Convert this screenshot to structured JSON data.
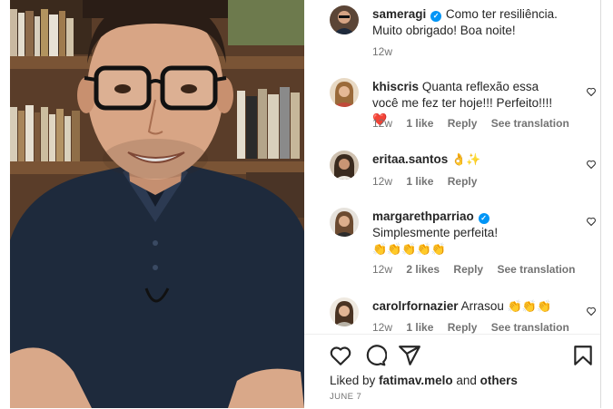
{
  "comments": [
    {
      "username": "sameragi",
      "verified": true,
      "text": "Como ter resiliência. Muito obrigado! Boa noite!",
      "time": "12w"
    },
    {
      "username": "khiscris",
      "verified": false,
      "text": "Quanta reflexão essa você me fez ter hoje!!! Perfeito!!!!",
      "emoji": "❤️",
      "time": "12w",
      "likes": "1 like",
      "reply": "Reply",
      "translate": "See translation"
    },
    {
      "username": "eritaa.santos",
      "verified": false,
      "text": "",
      "emoji": "👌✨",
      "time": "12w",
      "likes": "1 like",
      "reply": "Reply"
    },
    {
      "username": "margarethparriao",
      "verified": true,
      "text": "Simplesmente perfeita!",
      "emoji": "👏👏👏👏👏",
      "time": "12w",
      "likes": "2 likes",
      "reply": "Reply",
      "translate": "See translation"
    },
    {
      "username": "carolrfornazier",
      "verified": false,
      "text": "Arrasou",
      "emoji": "👏👏👏",
      "time": "12w",
      "likes": "1 like",
      "reply": "Reply",
      "translate": "See translation"
    }
  ],
  "footer": {
    "liked_prefix": "Liked by",
    "liked_user": "fatimav.melo",
    "liked_and": "and",
    "liked_others": "others",
    "date": "JUNE 7"
  },
  "icons": {
    "like": "heart-icon",
    "comment": "comment-icon",
    "share": "send-icon",
    "save": "bookmark-icon"
  }
}
